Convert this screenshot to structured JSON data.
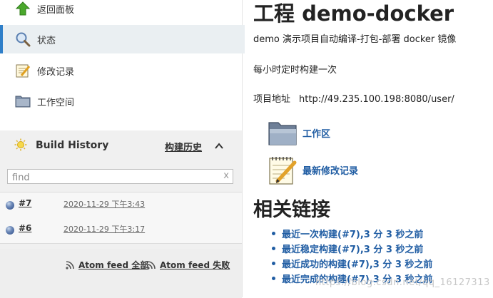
{
  "sidebar": {
    "tasks": [
      {
        "label": "返回面板",
        "icon": "up-arrow-icon"
      },
      {
        "label": "状态",
        "icon": "magnifier-icon"
      },
      {
        "label": "修改记录",
        "icon": "notepad-icon"
      },
      {
        "label": "工作空间",
        "icon": "folder-icon"
      }
    ]
  },
  "build_history": {
    "title": "Build History",
    "trend_link": "构建历史",
    "search_placeholder": "find",
    "clear_label": "x",
    "builds": [
      {
        "number": "#7",
        "date": "2020-11-29 下午3:43",
        "status_color": "#2b4a86"
      },
      {
        "number": "#6",
        "date": "2020-11-29 下午3:17",
        "status_color": "#2b4a86"
      }
    ],
    "feeds": {
      "all": "Atom feed 全部",
      "failed": "Atom feed 失败"
    }
  },
  "main": {
    "title": "工程 demo-docker",
    "description": "demo 演示项目自动编译-打包-部署 docker 镜像",
    "schedule": "每小时定时构建一次",
    "project_url_label": "项目地址",
    "project_url": "http://49.235.100.198:8080/user/",
    "links": {
      "workspace": "工作区",
      "recent_changes": "最新修改记录"
    },
    "related_heading": "相关链接",
    "permalinks": [
      "最近一次构建(#7),3 分 3 秒之前",
      "最近稳定构建(#7),3 分 3 秒之前",
      "最近成功的构建(#7),3 分 3 秒之前",
      "最近完成的构建(#7),3 分 3 秒之前"
    ]
  },
  "watermark": "https://blog.csdn.net/qq_16127313",
  "colors": {
    "link": "#205da3",
    "selected_bg": "#eaeff2",
    "selected_bar": "#2f7fc9",
    "history_bg": "#f0f0f0"
  }
}
